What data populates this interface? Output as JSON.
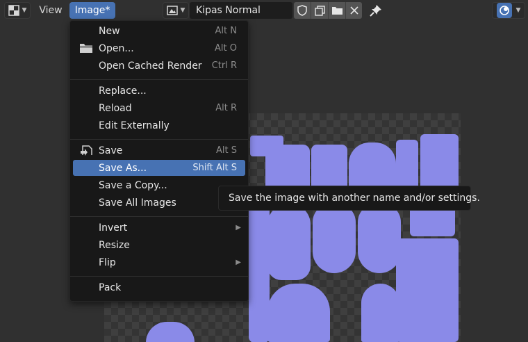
{
  "header": {
    "view_label": "View",
    "image_menu_label": "Image*",
    "image_name": "Kipas Normal"
  },
  "menu": {
    "items": [
      {
        "label": "New",
        "shortcut": "Alt N"
      },
      {
        "label": "Open...",
        "shortcut": "Alt O"
      },
      {
        "label": "Open Cached Render",
        "shortcut": "Ctrl R"
      },
      {
        "label": "Replace...",
        "shortcut": ""
      },
      {
        "label": "Reload",
        "shortcut": "Alt R"
      },
      {
        "label": "Edit Externally",
        "shortcut": ""
      },
      {
        "label": "Save",
        "shortcut": "Alt S"
      },
      {
        "label": "Save As...",
        "shortcut": "Shift Alt S"
      },
      {
        "label": "Save a Copy...",
        "shortcut": ""
      },
      {
        "label": "Save All Images",
        "shortcut": ""
      },
      {
        "label": "Invert",
        "shortcut": ""
      },
      {
        "label": "Resize",
        "shortcut": ""
      },
      {
        "label": "Flip",
        "shortcut": ""
      },
      {
        "label": "Pack",
        "shortcut": ""
      }
    ],
    "active_item": "Save As..."
  },
  "tooltip": {
    "text": "Save the image with another name and/or settings."
  },
  "colors": {
    "accent": "#4772b3",
    "menu_bg": "#181818",
    "uv_islands": "#8a8ae8"
  },
  "icons": [
    "image-editor-icon",
    "image-browse-icon",
    "shield-icon",
    "duplicate-icon",
    "folder-icon",
    "close-icon",
    "pin-icon",
    "gizmo-icon",
    "chevron-down-icon",
    "folder-open-icon",
    "save-file-icon",
    "submenu-arrow-icon"
  ]
}
